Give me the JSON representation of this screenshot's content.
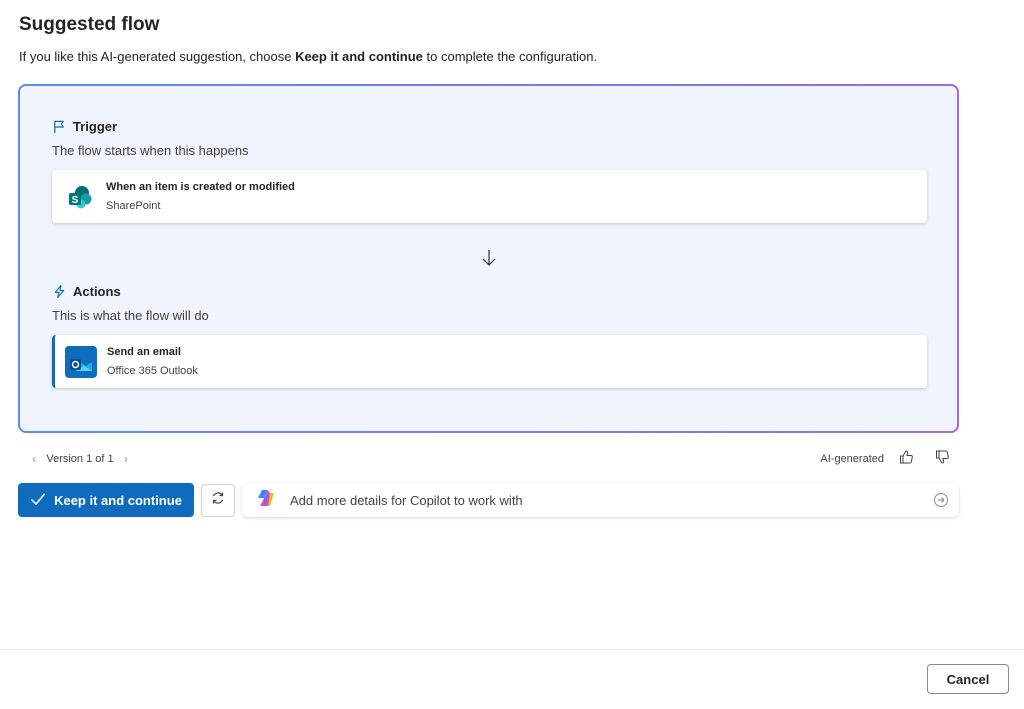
{
  "header": {
    "title": "Suggested flow",
    "subtitle_prefix": "If you like this AI-generated suggestion, choose ",
    "subtitle_bold": "Keep it and continue",
    "subtitle_suffix": " to complete the configuration."
  },
  "trigger": {
    "heading": "Trigger",
    "description": "The flow starts when this happens",
    "icon": "flag-icon",
    "step": {
      "title": "When an item is created or modified",
      "connector": "SharePoint",
      "icon": "sharepoint-icon"
    }
  },
  "actions": {
    "heading": "Actions",
    "description": "This is what the flow will do",
    "icon": "lightning-icon",
    "step": {
      "title": "Send an email",
      "connector": "Office 365 Outlook",
      "icon": "outlook-icon"
    }
  },
  "version": {
    "label": "Version 1 of 1"
  },
  "feedback": {
    "label": "AI-generated"
  },
  "footer_actions": {
    "keep_label": "Keep it and continue",
    "copilot_placeholder": "Add more details for Copilot to work with"
  },
  "dialog": {
    "cancel_label": "Cancel"
  },
  "colors": {
    "primary": "#0f6cbd",
    "card_bg": "#eff4fd",
    "border_gradient_start": "#5b8def",
    "border_gradient_end": "#a06bd8"
  }
}
